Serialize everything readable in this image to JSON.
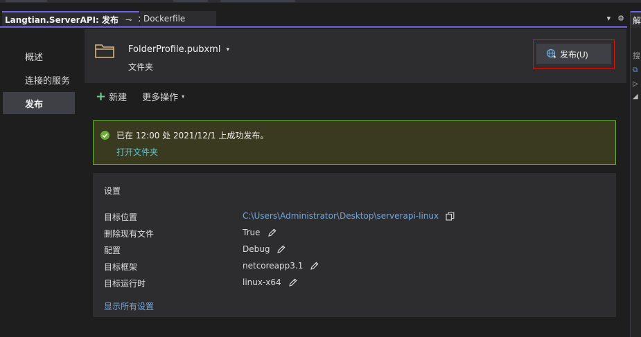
{
  "tabs": {
    "active_title": "Langtian.ServerAPI: 发布",
    "inactive_title": "Dockerfile",
    "pin_glyph": "⊸",
    "close_glyph": "×",
    "menu_glyph": "▾",
    "gear_glyph": "⚙"
  },
  "right_panel": {
    "title": "解",
    "item1": "搜",
    "item2": "⧉",
    "item3": "▷",
    "item4": "◢"
  },
  "sidebar": {
    "items": [
      {
        "label": "概述"
      },
      {
        "label": "连接的服务"
      },
      {
        "label": "发布"
      }
    ],
    "active_index": 2
  },
  "profile": {
    "name": "FolderProfile.pubxml",
    "caret": "▾",
    "subtitle": "文件夹",
    "publish_label": "发布(U)",
    "folder_color": "#dcb67a"
  },
  "actions": {
    "new_label": "新建",
    "new_glyph": "+",
    "more_label": "更多操作",
    "more_caret": "▾"
  },
  "status": {
    "message": "已在 12:00 处 2021/12/1 上成功发布。",
    "open_folder_label": "打开文件夹",
    "success_color": "#6bb035"
  },
  "settings": {
    "title": "设置",
    "rows": [
      {
        "label": "目标位置",
        "value": "C:\\Users\\Administrator\\Desktop\\serverapi-linux",
        "action_icon": "copy-icon"
      },
      {
        "label": "删除现有文件",
        "value": "True",
        "action_icon": "edit-icon"
      },
      {
        "label": "配置",
        "value": "Debug",
        "action_icon": "edit-icon"
      },
      {
        "label": "目标框架",
        "value": "netcoreapp3.1",
        "action_icon": "edit-icon"
      },
      {
        "label": "目标运行时",
        "value": "linux-x64",
        "action_icon": "edit-icon"
      }
    ],
    "show_all_label": "显示所有设置"
  },
  "colors": {
    "accent": "#7160e8",
    "link": "#6fa8dc",
    "highlight_border": "#e51400"
  }
}
